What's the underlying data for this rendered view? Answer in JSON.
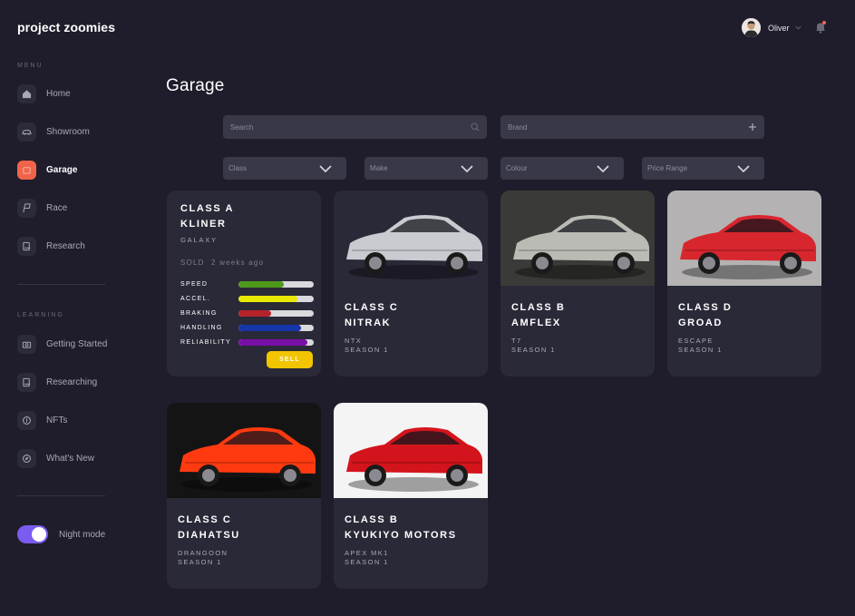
{
  "app": {
    "logo": "project zoomies"
  },
  "sidebar": {
    "menu_label": "MENU",
    "menu_items": [
      {
        "label": "Home",
        "icon": "home-icon"
      },
      {
        "label": "Showroom",
        "icon": "car-icon"
      },
      {
        "label": "Garage",
        "icon": "garage-icon",
        "active": true
      },
      {
        "label": "Race",
        "icon": "flag-icon"
      },
      {
        "label": "Research",
        "icon": "research-icon"
      }
    ],
    "learning_label": "LEARNING",
    "learning_items": [
      {
        "label": "Getting Started",
        "icon": "camera-icon"
      },
      {
        "label": "Researching",
        "icon": "research-icon"
      },
      {
        "label": "NFTs",
        "icon": "coin-icon"
      },
      {
        "label": "What's New",
        "icon": "compass-icon"
      }
    ],
    "night_mode_label": "Night mode",
    "night_mode_on": true
  },
  "header": {
    "user_name": "Oliver"
  },
  "page": {
    "title": "Garage"
  },
  "filters": {
    "search_placeholder": "Search",
    "brand_placeholder": "Brand",
    "class_label": "Class",
    "make_label": "Make",
    "colour_label": "Colour",
    "price_label": "Price Range"
  },
  "detail_card": {
    "class": "CLASS A",
    "name": "KLINER",
    "model": "GALAXY",
    "sold_label": "SOLD",
    "sold_time": "2 weeks ago",
    "stats": [
      {
        "label": "SPEED",
        "value": 0.6,
        "color": "#4f9a1b"
      },
      {
        "label": "ACCEL.",
        "value": 0.78,
        "color": "#e8e800"
      },
      {
        "label": "BRAKING",
        "value": 0.43,
        "color": "#b5222a"
      },
      {
        "label": "HANDLING",
        "value": 0.83,
        "color": "#1535a8"
      },
      {
        "label": "RELIABILITY",
        "value": 0.92,
        "color": "#7a0fa8"
      }
    ],
    "sell_label": "SELL"
  },
  "cars": [
    {
      "class": "CLASS C",
      "name": "NITRAK",
      "model": "NTX",
      "season": "SEASON 1",
      "color": "#c9cbd0",
      "bg": "#2a2938"
    },
    {
      "class": "CLASS B",
      "name": "AMFLEX",
      "model": "T7",
      "season": "SEASON 1",
      "color": "#b9bbb4",
      "bg": "#3a3b38"
    },
    {
      "class": "CLASS D",
      "name": "GROAD",
      "model": "ESCAPE",
      "season": "SEASON 1",
      "color": "#d8262e",
      "bg": "#b4b2b3"
    },
    {
      "class": "CLASS C",
      "name": "DIAHATSU",
      "model": "DRANGOON",
      "season": "SEASON 1",
      "color": "#ff3a10",
      "bg": "#141414"
    },
    {
      "class": "CLASS B",
      "name": "KYUKIYO MOTORS",
      "model": "APEX MK1",
      "season": "SEASON 1",
      "color": "#d4141c",
      "bg": "#f4f4f4"
    }
  ]
}
